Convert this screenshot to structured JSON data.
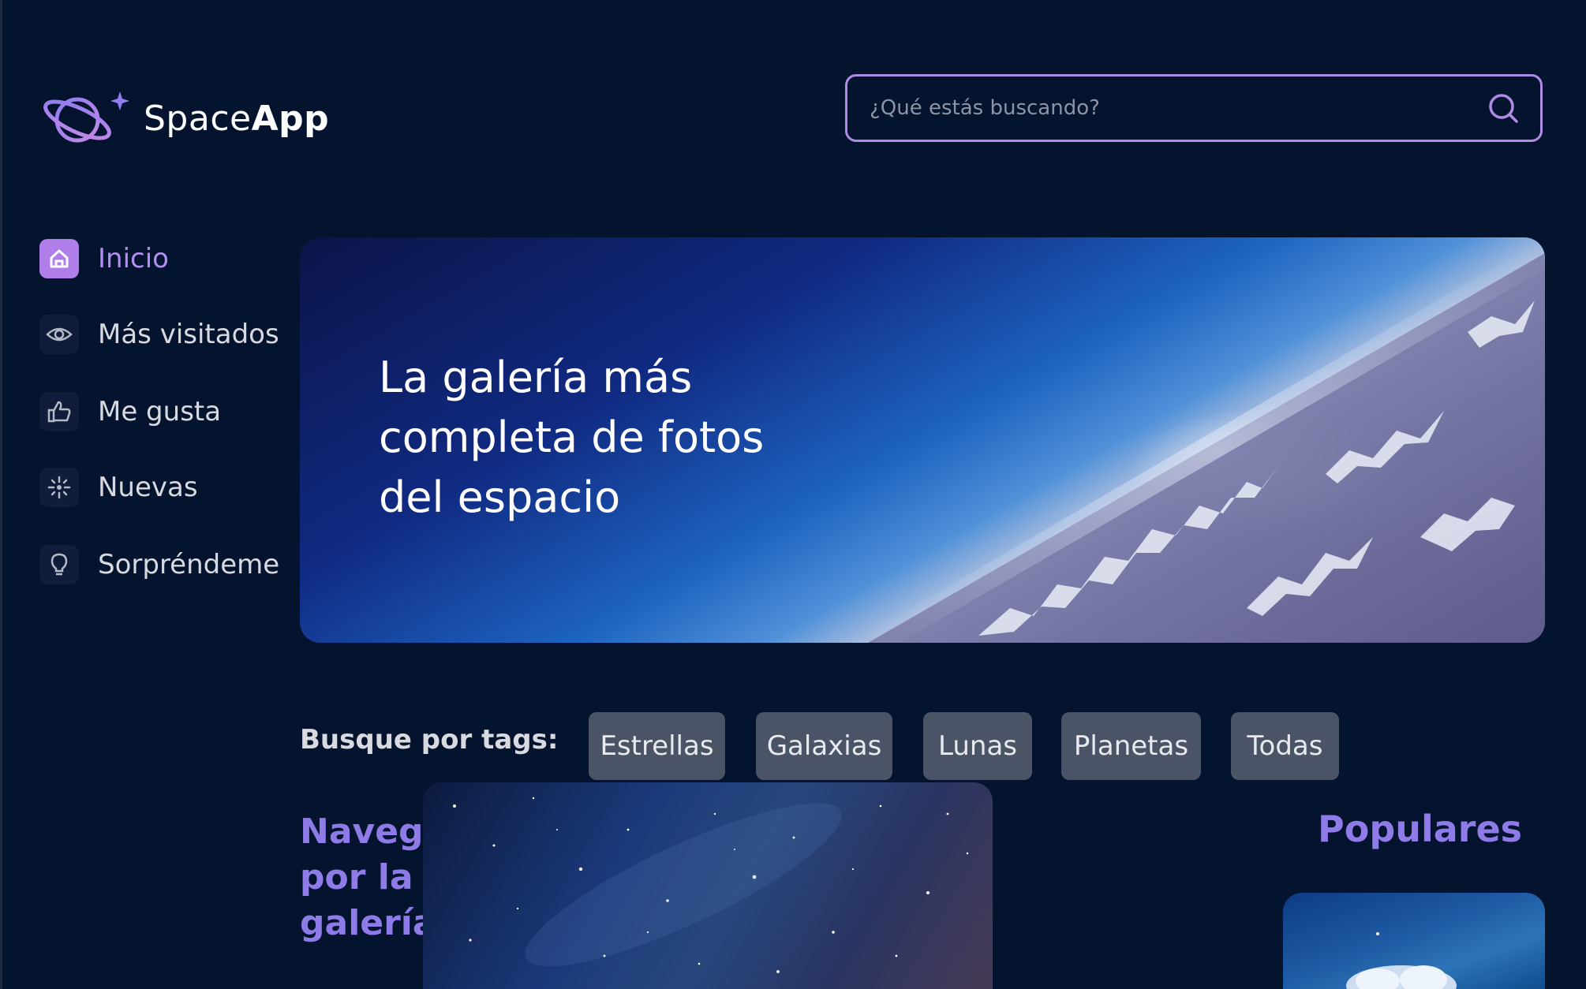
{
  "app": {
    "brand_light": "Space",
    "brand_bold": "App"
  },
  "search": {
    "placeholder": "¿Qué estás buscando?",
    "value": ""
  },
  "sidebar": {
    "items": [
      {
        "label": "Inicio",
        "icon": "home-icon",
        "active": true
      },
      {
        "label": "Más visitados",
        "icon": "eye-icon",
        "active": false
      },
      {
        "label": "Me gusta",
        "icon": "thumbs-up-icon",
        "active": false
      },
      {
        "label": "Nuevas",
        "icon": "sparkle-icon",
        "active": false
      },
      {
        "label": "Sorpréndeme",
        "icon": "lightbulb-icon",
        "active": false
      }
    ]
  },
  "banner": {
    "title": "La galería más completa de fotos del espacio"
  },
  "tags": {
    "label": "Busque por tags:",
    "items": [
      "Estrellas",
      "Galaxias",
      "Lunas",
      "Planetas",
      "Todas"
    ]
  },
  "gallery": {
    "heading": "Navega por la galería"
  },
  "popular": {
    "heading": "Populares"
  },
  "colors": {
    "background": "#04142f",
    "accent": "#b08be6",
    "heading_accent": "#8e7be8",
    "tag_bg": "#4a5466"
  }
}
